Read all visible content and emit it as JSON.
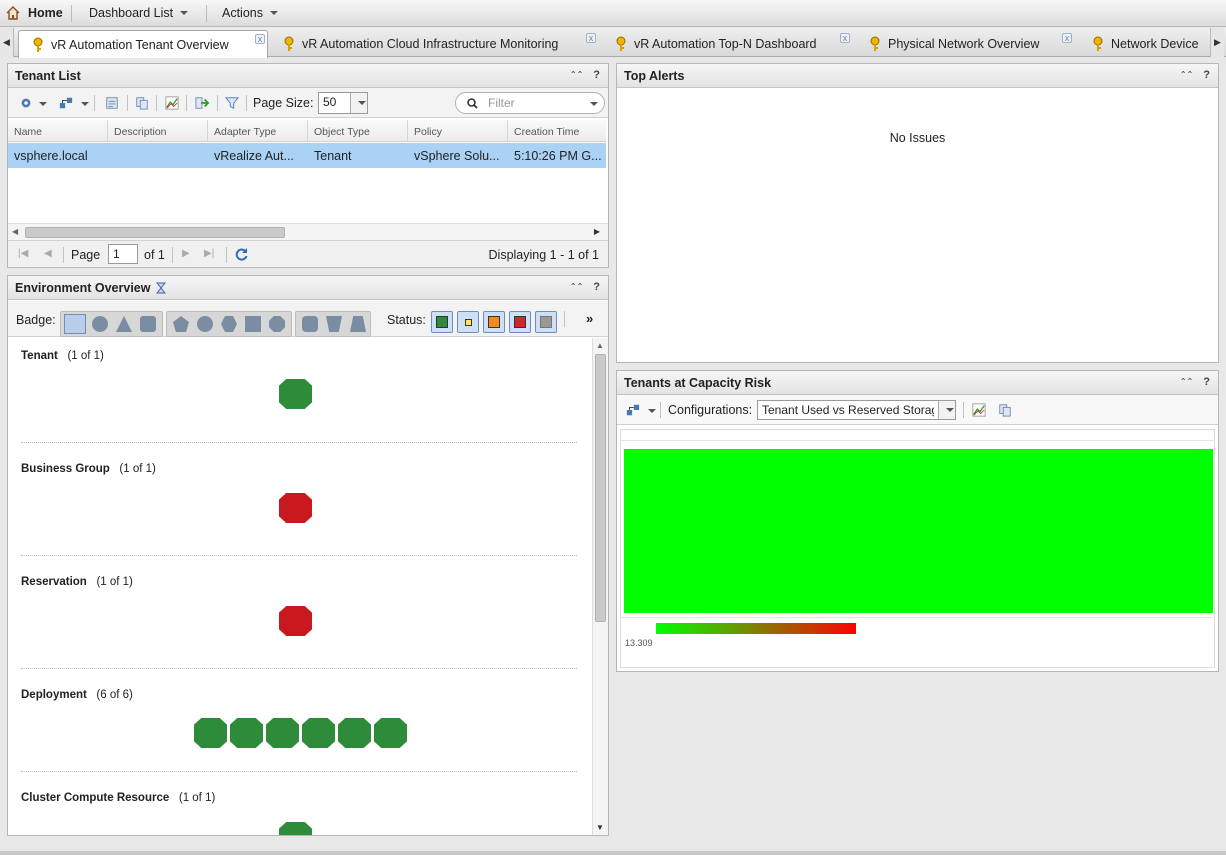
{
  "topnav": {
    "home": "Home",
    "dashboard_list": "Dashboard List",
    "actions": "Actions"
  },
  "tabs": [
    {
      "label": "vR Automation Tenant Overview"
    },
    {
      "label": "vR Automation Cloud Infrastructure Monitoring"
    },
    {
      "label": "vR Automation Top-N Dashboard"
    },
    {
      "label": "Physical Network Overview"
    },
    {
      "label": "Network Device"
    }
  ],
  "tenant_list": {
    "title": "Tenant List",
    "page_size_label": "Page Size:",
    "page_size": "50",
    "filter_placeholder": "Filter",
    "columns": [
      "Name",
      "Description",
      "Adapter Type",
      "Object Type",
      "Policy",
      "Creation Time"
    ],
    "rows": [
      {
        "name": "vsphere.local",
        "description": "",
        "adapter_type": "vRealize Aut...",
        "object_type": "Tenant",
        "policy": "vSphere Solu...",
        "creation_time": "5:10:26 PM G..."
      }
    ],
    "page_label": "Page",
    "page": "1",
    "of_pages": "of 1",
    "displaying": "Displaying 1 - 1 of 1"
  },
  "env": {
    "title": "Environment Overview",
    "badge_label": "Badge:",
    "status_label": "Status:",
    "more": "»",
    "groups": [
      {
        "name": "Tenant",
        "count": "(1 of 1)",
        "status": [
          "green"
        ]
      },
      {
        "name": "Business Group",
        "count": "(1 of 1)",
        "status": [
          "red"
        ]
      },
      {
        "name": "Reservation",
        "count": "(1 of 1)",
        "status": [
          "red"
        ]
      },
      {
        "name": "Deployment",
        "count": "(6 of 6)",
        "status": [
          "green",
          "green",
          "green",
          "green",
          "green",
          "green"
        ]
      },
      {
        "name": "Cluster Compute Resource",
        "count": "(1 of 1)",
        "status": [
          "green"
        ]
      }
    ]
  },
  "top_alerts": {
    "title": "Top Alerts",
    "empty_text": "No Issues"
  },
  "capacity": {
    "title": "Tenants at Capacity Risk",
    "config_label": "Configurations:",
    "config_value": "Tenant Used vs Reserved Storage",
    "scale_min": "13.309",
    "colors": {
      "good": "#00ff00",
      "bad": "#ff0000"
    }
  },
  "panel_controls": {
    "collapse": "⌃⌃",
    "help": "?"
  }
}
